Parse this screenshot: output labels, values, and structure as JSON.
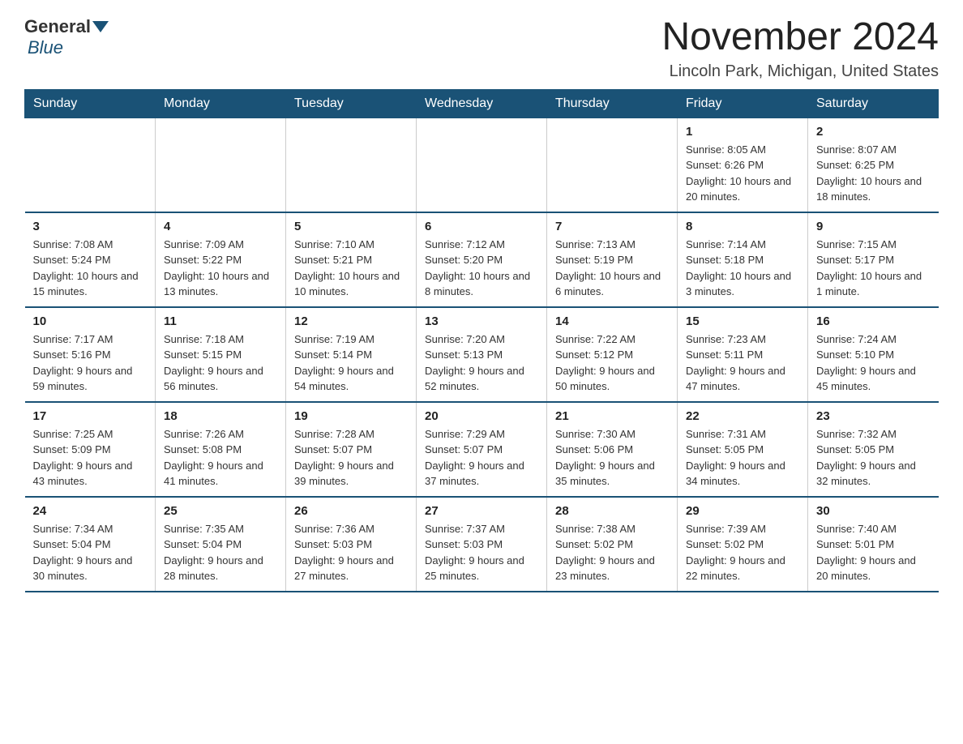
{
  "logo": {
    "general": "General",
    "blue": "Blue"
  },
  "header": {
    "title": "November 2024",
    "location": "Lincoln Park, Michigan, United States"
  },
  "weekdays": [
    "Sunday",
    "Monday",
    "Tuesday",
    "Wednesday",
    "Thursday",
    "Friday",
    "Saturday"
  ],
  "weeks": [
    [
      {
        "day": "",
        "sunrise": "",
        "sunset": "",
        "daylight": ""
      },
      {
        "day": "",
        "sunrise": "",
        "sunset": "",
        "daylight": ""
      },
      {
        "day": "",
        "sunrise": "",
        "sunset": "",
        "daylight": ""
      },
      {
        "day": "",
        "sunrise": "",
        "sunset": "",
        "daylight": ""
      },
      {
        "day": "",
        "sunrise": "",
        "sunset": "",
        "daylight": ""
      },
      {
        "day": "1",
        "sunrise": "Sunrise: 8:05 AM",
        "sunset": "Sunset: 6:26 PM",
        "daylight": "Daylight: 10 hours and 20 minutes."
      },
      {
        "day": "2",
        "sunrise": "Sunrise: 8:07 AM",
        "sunset": "Sunset: 6:25 PM",
        "daylight": "Daylight: 10 hours and 18 minutes."
      }
    ],
    [
      {
        "day": "3",
        "sunrise": "Sunrise: 7:08 AM",
        "sunset": "Sunset: 5:24 PM",
        "daylight": "Daylight: 10 hours and 15 minutes."
      },
      {
        "day": "4",
        "sunrise": "Sunrise: 7:09 AM",
        "sunset": "Sunset: 5:22 PM",
        "daylight": "Daylight: 10 hours and 13 minutes."
      },
      {
        "day": "5",
        "sunrise": "Sunrise: 7:10 AM",
        "sunset": "Sunset: 5:21 PM",
        "daylight": "Daylight: 10 hours and 10 minutes."
      },
      {
        "day": "6",
        "sunrise": "Sunrise: 7:12 AM",
        "sunset": "Sunset: 5:20 PM",
        "daylight": "Daylight: 10 hours and 8 minutes."
      },
      {
        "day": "7",
        "sunrise": "Sunrise: 7:13 AM",
        "sunset": "Sunset: 5:19 PM",
        "daylight": "Daylight: 10 hours and 6 minutes."
      },
      {
        "day": "8",
        "sunrise": "Sunrise: 7:14 AM",
        "sunset": "Sunset: 5:18 PM",
        "daylight": "Daylight: 10 hours and 3 minutes."
      },
      {
        "day": "9",
        "sunrise": "Sunrise: 7:15 AM",
        "sunset": "Sunset: 5:17 PM",
        "daylight": "Daylight: 10 hours and 1 minute."
      }
    ],
    [
      {
        "day": "10",
        "sunrise": "Sunrise: 7:17 AM",
        "sunset": "Sunset: 5:16 PM",
        "daylight": "Daylight: 9 hours and 59 minutes."
      },
      {
        "day": "11",
        "sunrise": "Sunrise: 7:18 AM",
        "sunset": "Sunset: 5:15 PM",
        "daylight": "Daylight: 9 hours and 56 minutes."
      },
      {
        "day": "12",
        "sunrise": "Sunrise: 7:19 AM",
        "sunset": "Sunset: 5:14 PM",
        "daylight": "Daylight: 9 hours and 54 minutes."
      },
      {
        "day": "13",
        "sunrise": "Sunrise: 7:20 AM",
        "sunset": "Sunset: 5:13 PM",
        "daylight": "Daylight: 9 hours and 52 minutes."
      },
      {
        "day": "14",
        "sunrise": "Sunrise: 7:22 AM",
        "sunset": "Sunset: 5:12 PM",
        "daylight": "Daylight: 9 hours and 50 minutes."
      },
      {
        "day": "15",
        "sunrise": "Sunrise: 7:23 AM",
        "sunset": "Sunset: 5:11 PM",
        "daylight": "Daylight: 9 hours and 47 minutes."
      },
      {
        "day": "16",
        "sunrise": "Sunrise: 7:24 AM",
        "sunset": "Sunset: 5:10 PM",
        "daylight": "Daylight: 9 hours and 45 minutes."
      }
    ],
    [
      {
        "day": "17",
        "sunrise": "Sunrise: 7:25 AM",
        "sunset": "Sunset: 5:09 PM",
        "daylight": "Daylight: 9 hours and 43 minutes."
      },
      {
        "day": "18",
        "sunrise": "Sunrise: 7:26 AM",
        "sunset": "Sunset: 5:08 PM",
        "daylight": "Daylight: 9 hours and 41 minutes."
      },
      {
        "day": "19",
        "sunrise": "Sunrise: 7:28 AM",
        "sunset": "Sunset: 5:07 PM",
        "daylight": "Daylight: 9 hours and 39 minutes."
      },
      {
        "day": "20",
        "sunrise": "Sunrise: 7:29 AM",
        "sunset": "Sunset: 5:07 PM",
        "daylight": "Daylight: 9 hours and 37 minutes."
      },
      {
        "day": "21",
        "sunrise": "Sunrise: 7:30 AM",
        "sunset": "Sunset: 5:06 PM",
        "daylight": "Daylight: 9 hours and 35 minutes."
      },
      {
        "day": "22",
        "sunrise": "Sunrise: 7:31 AM",
        "sunset": "Sunset: 5:05 PM",
        "daylight": "Daylight: 9 hours and 34 minutes."
      },
      {
        "day": "23",
        "sunrise": "Sunrise: 7:32 AM",
        "sunset": "Sunset: 5:05 PM",
        "daylight": "Daylight: 9 hours and 32 minutes."
      }
    ],
    [
      {
        "day": "24",
        "sunrise": "Sunrise: 7:34 AM",
        "sunset": "Sunset: 5:04 PM",
        "daylight": "Daylight: 9 hours and 30 minutes."
      },
      {
        "day": "25",
        "sunrise": "Sunrise: 7:35 AM",
        "sunset": "Sunset: 5:04 PM",
        "daylight": "Daylight: 9 hours and 28 minutes."
      },
      {
        "day": "26",
        "sunrise": "Sunrise: 7:36 AM",
        "sunset": "Sunset: 5:03 PM",
        "daylight": "Daylight: 9 hours and 27 minutes."
      },
      {
        "day": "27",
        "sunrise": "Sunrise: 7:37 AM",
        "sunset": "Sunset: 5:03 PM",
        "daylight": "Daylight: 9 hours and 25 minutes."
      },
      {
        "day": "28",
        "sunrise": "Sunrise: 7:38 AM",
        "sunset": "Sunset: 5:02 PM",
        "daylight": "Daylight: 9 hours and 23 minutes."
      },
      {
        "day": "29",
        "sunrise": "Sunrise: 7:39 AM",
        "sunset": "Sunset: 5:02 PM",
        "daylight": "Daylight: 9 hours and 22 minutes."
      },
      {
        "day": "30",
        "sunrise": "Sunrise: 7:40 AM",
        "sunset": "Sunset: 5:01 PM",
        "daylight": "Daylight: 9 hours and 20 minutes."
      }
    ]
  ]
}
